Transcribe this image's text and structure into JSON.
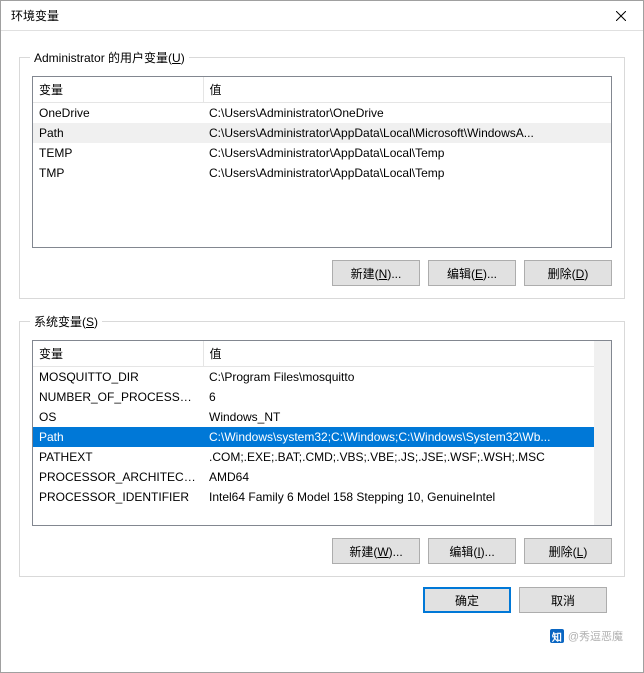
{
  "titlebar": {
    "title": "环境变量"
  },
  "user_section": {
    "label_prefix": "Administrator 的用户变量(",
    "label_key": "U",
    "label_suffix": ")",
    "columns": {
      "var": "变量",
      "val": "值"
    },
    "rows": [
      {
        "var": "OneDrive",
        "val": "C:\\Users\\Administrator\\OneDrive",
        "selected": false
      },
      {
        "var": "Path",
        "val": "C:\\Users\\Administrator\\AppData\\Local\\Microsoft\\WindowsA...",
        "selected": true
      },
      {
        "var": "TEMP",
        "val": "C:\\Users\\Administrator\\AppData\\Local\\Temp",
        "selected": false
      },
      {
        "var": "TMP",
        "val": "C:\\Users\\Administrator\\AppData\\Local\\Temp",
        "selected": false
      }
    ],
    "buttons": {
      "new_prefix": "新建(",
      "new_key": "N",
      "new_suffix": ")...",
      "edit_prefix": "编辑(",
      "edit_key": "E",
      "edit_suffix": ")...",
      "del_prefix": "删除(",
      "del_key": "D",
      "del_suffix": ")"
    }
  },
  "system_section": {
    "label_prefix": "系统变量(",
    "label_key": "S",
    "label_suffix": ")",
    "columns": {
      "var": "变量",
      "val": "值"
    },
    "rows": [
      {
        "var": "MOSQUITTO_DIR",
        "val": "C:\\Program Files\\mosquitto",
        "selected": false
      },
      {
        "var": "NUMBER_OF_PROCESSORS",
        "val": "6",
        "selected": false
      },
      {
        "var": "OS",
        "val": "Windows_NT",
        "selected": false
      },
      {
        "var": "Path",
        "val": "C:\\Windows\\system32;C:\\Windows;C:\\Windows\\System32\\Wb...",
        "selected": true
      },
      {
        "var": "PATHEXT",
        "val": ".COM;.EXE;.BAT;.CMD;.VBS;.VBE;.JS;.JSE;.WSF;.WSH;.MSC",
        "selected": false
      },
      {
        "var": "PROCESSOR_ARCHITECT...",
        "val": "AMD64",
        "selected": false
      },
      {
        "var": "PROCESSOR_IDENTIFIER",
        "val": "Intel64 Family 6 Model 158 Stepping 10, GenuineIntel",
        "selected": false
      }
    ],
    "buttons": {
      "new_prefix": "新建(",
      "new_key": "W",
      "new_suffix": ")...",
      "edit_prefix": "编辑(",
      "edit_key": "I",
      "edit_suffix": ")...",
      "del_prefix": "删除(",
      "del_key": "L",
      "del_suffix": ")"
    }
  },
  "footer": {
    "ok": "确定",
    "cancel": "取消"
  },
  "watermark": {
    "logo": "知",
    "text": "@秀逗恶魔"
  },
  "col_widths": {
    "var": 170,
    "val": 400
  }
}
